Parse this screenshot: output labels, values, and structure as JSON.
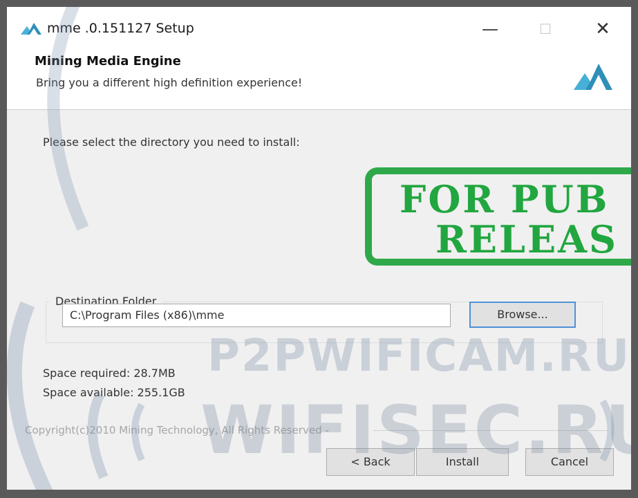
{
  "window": {
    "title": "mme .0.151127 Setup",
    "controls": {
      "minimize": "—",
      "maximize": "☐",
      "close": "✕"
    }
  },
  "header": {
    "product": "Mining Media Engine",
    "tagline": "Bring you a different high definition experience!",
    "logo_color": "#2f8fb8"
  },
  "body": {
    "prompt": "Please select the directory you need to install:"
  },
  "destination": {
    "label": "Destination Folder",
    "path": "C:\\Program Files (x86)\\mme",
    "browse_label": "Browse..."
  },
  "space": {
    "required": "Space required: 28.7MB",
    "available": "Space available: 255.1GB"
  },
  "footer": {
    "copyright": "Copyright(c)2010 Mining Technology, All Rights Reserved -"
  },
  "buttons": {
    "back": "< Back",
    "install": "Install",
    "cancel": "Cancel"
  },
  "overlays": {
    "stamp_line1": "FOR PUB",
    "stamp_line2": "RELEAS",
    "stamp_color": "#2fa84a",
    "watermark_1": "P2PWIFICAM.RU",
    "watermark_2": "WIFISEC.RU"
  },
  "colors": {
    "focus_border": "#4f91d6",
    "button_face": "#e1e1e1",
    "dialog_bg": "#f0f0f0"
  }
}
